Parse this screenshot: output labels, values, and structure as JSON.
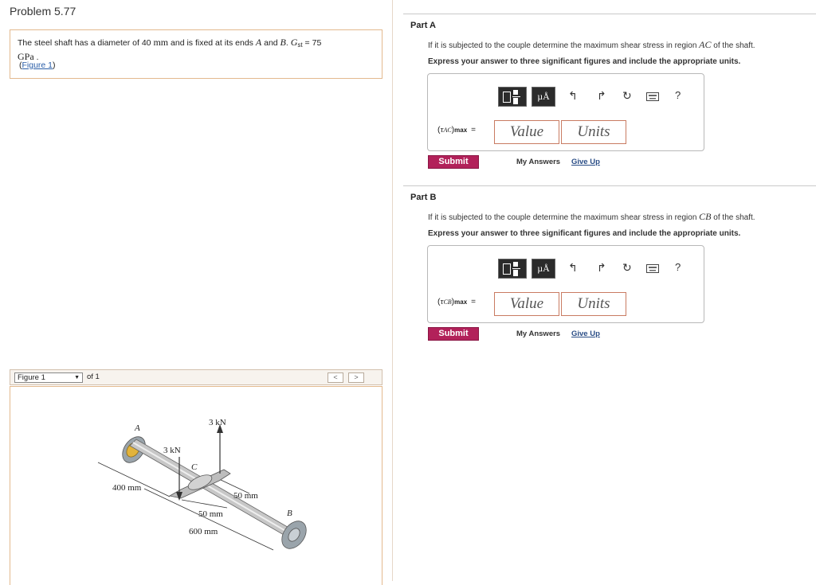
{
  "problem": {
    "title": "Problem 5.77",
    "text_1": "The steel shaft has a diameter of 40 ",
    "unit_mm": "mm",
    "text_2": " and is fixed at its ends ",
    "end_a": "A",
    "text_and": " and ",
    "end_b": "B",
    "text_dot": ". ",
    "g_sym": "G",
    "g_sub": "st",
    "g_eq": " = 75",
    "unit_gpa": "GPa",
    "unit_gpa_dot": " .",
    "figure_link_open": "(",
    "figure_link": "Figure 1",
    "figure_link_close": ")"
  },
  "figure_nav": {
    "selected": "Figure 1",
    "of_text": "of 1",
    "prev": "<",
    "next": ">"
  },
  "figure": {
    "label_a": "A",
    "label_b": "B",
    "label_c": "C",
    "force_top": "3 kN",
    "force_left": "3 kN",
    "dim_400": "400 mm",
    "dim_50_right": "50 mm",
    "dim_50_bottom": "50 mm",
    "dim_600": "600 mm"
  },
  "parts": [
    {
      "title": "Part A",
      "question_1": "If it is subjected to the couple determine the maximum shear stress in region ",
      "region": "AC",
      "question_2": " of the shaft.",
      "instruction": "Express your answer to three significant figures and include the appropriate units.",
      "symbol": "τ",
      "symbol_sub": "AC",
      "symbol_max": "max",
      "equals": "=",
      "value_placeholder": "Value",
      "units_placeholder": "Units",
      "units_toolbar": "µÅ",
      "help": "?",
      "submit": "Submit",
      "my_answers": "My Answers",
      "give_up": "Give Up"
    },
    {
      "title": "Part B",
      "question_1": "If it is subjected to the couple determine the maximum shear stress in region ",
      "region": "CB",
      "question_2": " of the shaft.",
      "instruction": "Express your answer to three significant figures and include the appropriate units.",
      "symbol": "τ",
      "symbol_sub": "CB",
      "symbol_max": "max",
      "equals": "=",
      "value_placeholder": "Value",
      "units_placeholder": "Units",
      "units_toolbar": "µÅ",
      "help": "?",
      "submit": "Submit",
      "my_answers": "My Answers",
      "give_up": "Give Up"
    }
  ],
  "colors": {
    "submit_bg": "#b2215a",
    "panel_border": "#e3b98e",
    "link": "#2a5ea8"
  }
}
